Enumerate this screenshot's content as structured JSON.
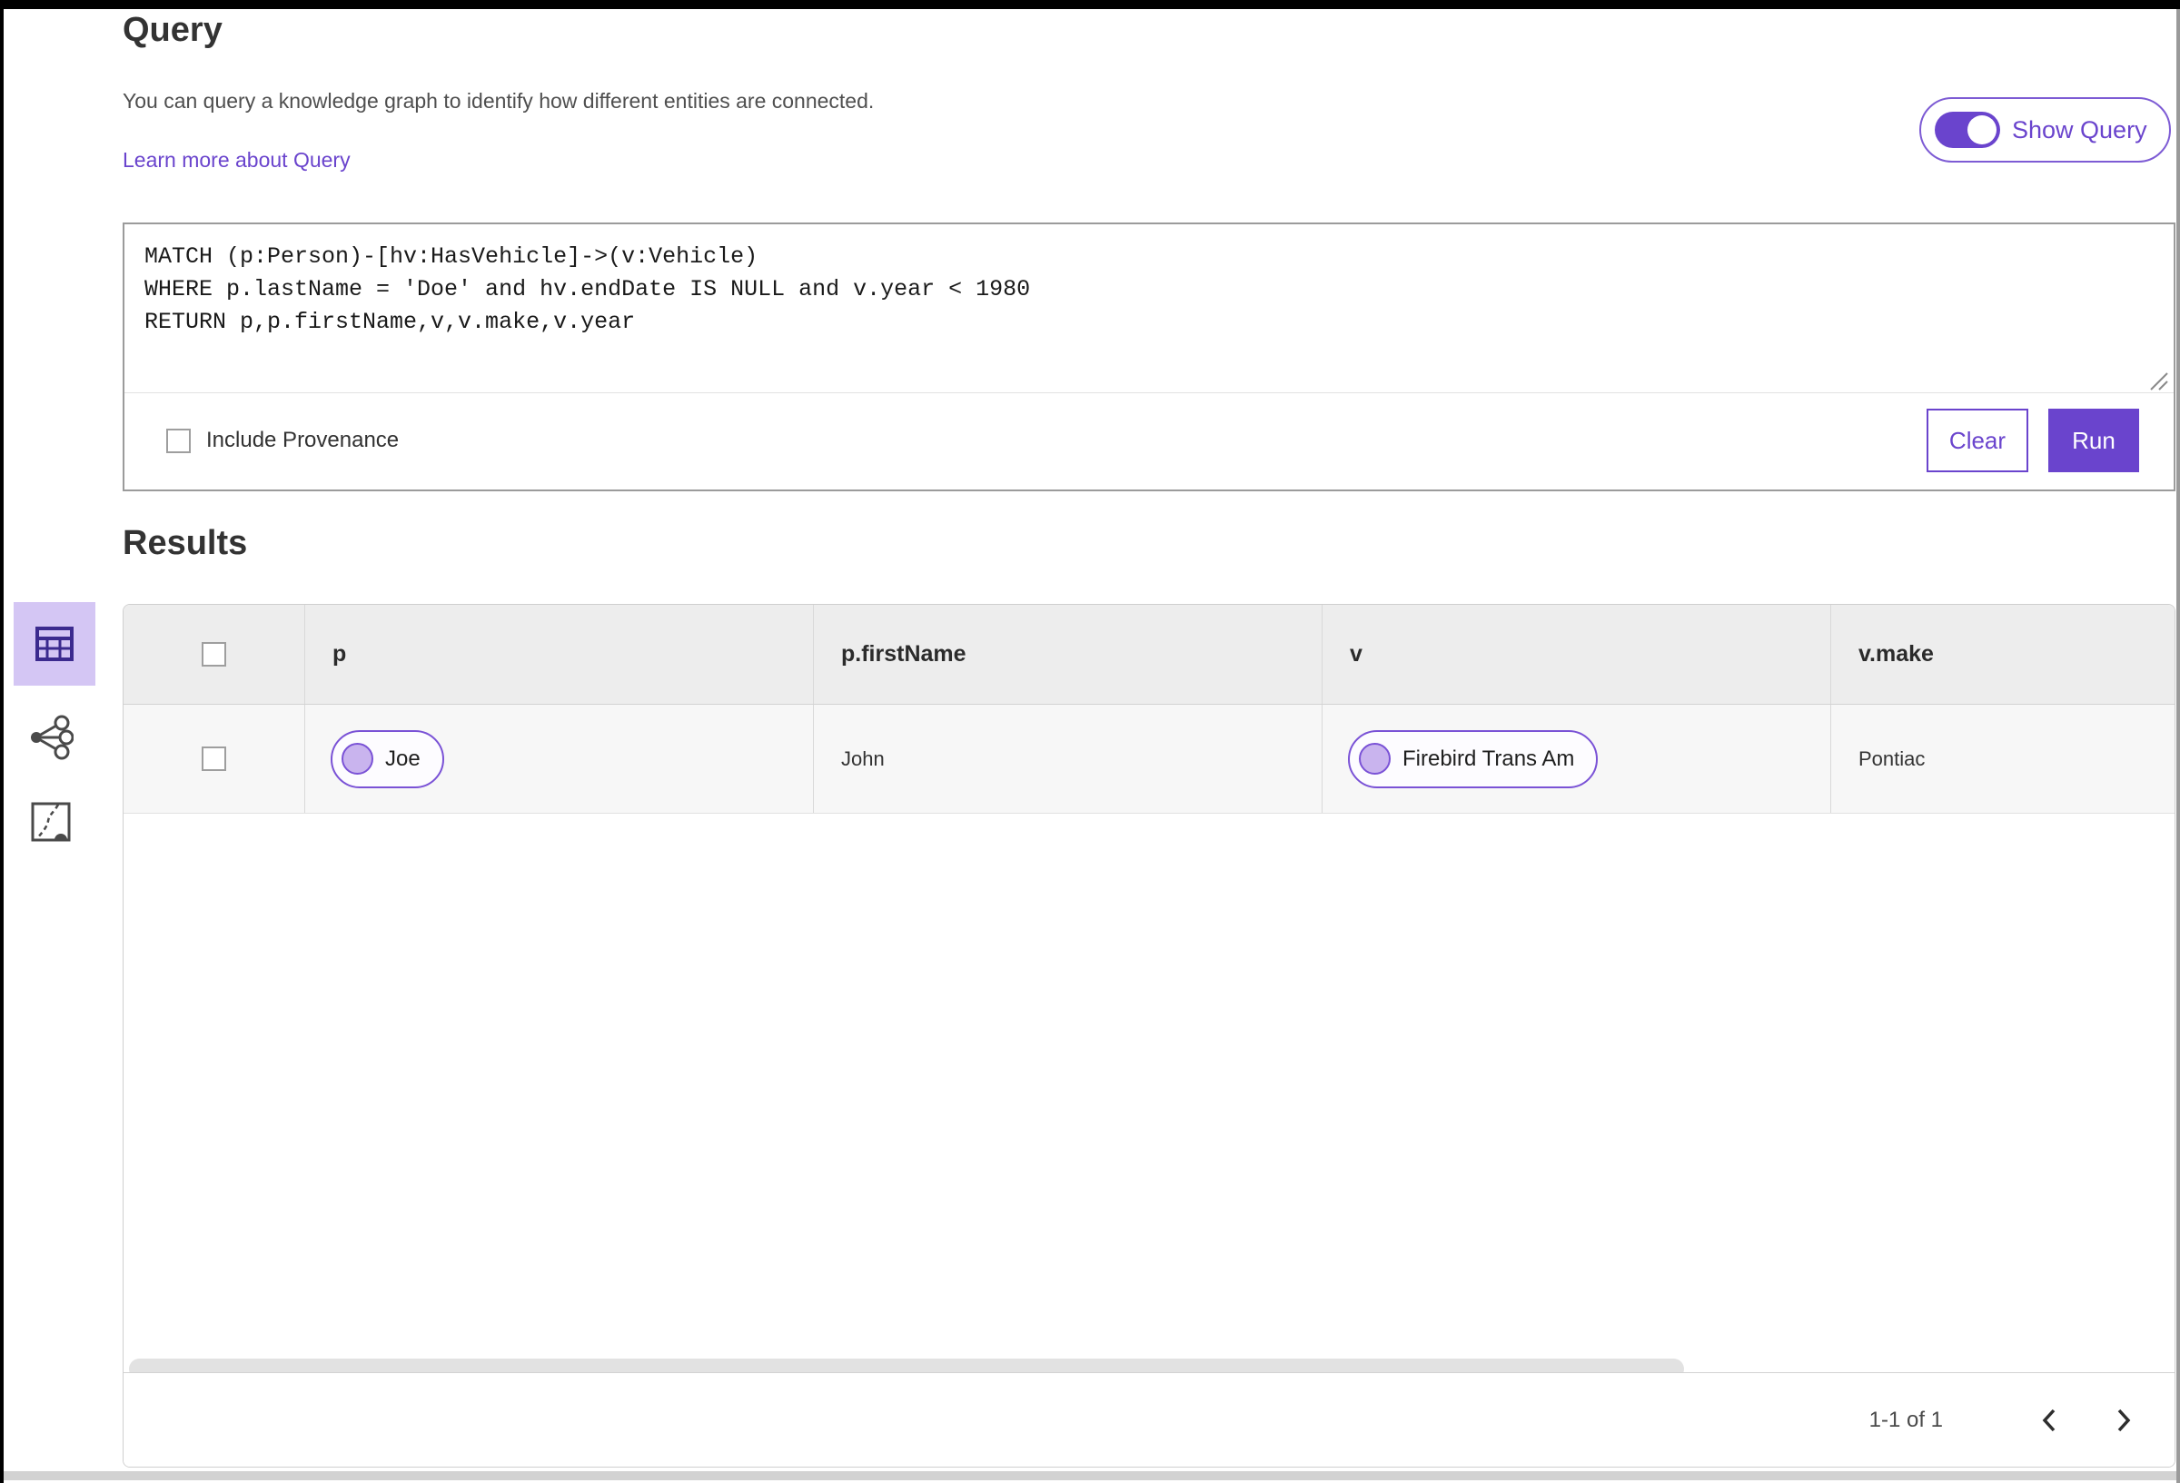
{
  "colors": {
    "accent": "#6a44cd",
    "entity_border": "#7a52d6",
    "selected_view_bg": "#d4c6f4"
  },
  "header": {
    "title": "Query",
    "description": "You can query a knowledge graph to identify how different entities are connected.",
    "learn_more_link": "Learn more about Query",
    "show_query": {
      "label": "Show Query",
      "on": true
    }
  },
  "query_panel": {
    "code": "MATCH (p:Person)-[hv:HasVehicle]->(v:Vehicle)\nWHERE p.lastName = 'Doe' and hv.endDate IS NULL and v.year < 1980\nRETURN p,p.firstName,v,v.make,v.year",
    "include_provenance": {
      "label": "Include Provenance",
      "checked": false
    },
    "buttons": {
      "clear": "Clear",
      "run": "Run"
    }
  },
  "results": {
    "title": "Results",
    "view_switcher": [
      {
        "name": "table-view",
        "icon": "table-icon",
        "selected": true
      },
      {
        "name": "link-chart-view",
        "icon": "link-chart-icon",
        "selected": false
      },
      {
        "name": "map-view",
        "icon": "map-icon",
        "selected": false
      }
    ],
    "table": {
      "select_all_checked": false,
      "columns": [
        "p",
        "p.firstName",
        "v",
        "v.make"
      ],
      "rows": [
        {
          "selected": false,
          "p": "Joe",
          "p_firstName": "John",
          "v": "Firebird Trans Am",
          "v_make": "Pontiac"
        }
      ]
    },
    "pagination": {
      "range": "1-1 of 1"
    }
  }
}
